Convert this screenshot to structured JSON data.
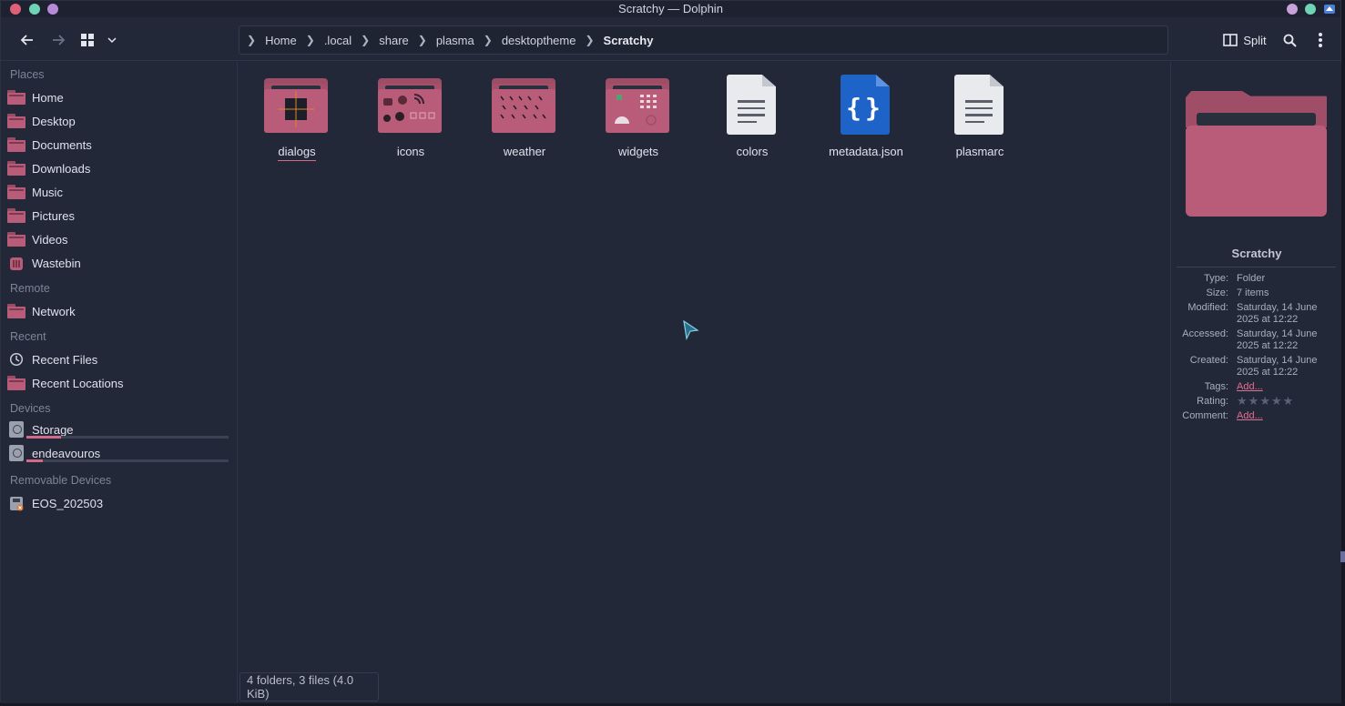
{
  "window": {
    "title": "Scratchy — Dolphin"
  },
  "colors": {
    "accent": "#d36a88",
    "folder": "#b85c79",
    "background": "#232838",
    "json_icon": "#1e63c7"
  },
  "toolbar": {
    "back_icon": "arrow-left-icon",
    "forward_icon": "arrow-right-icon",
    "view_icon": "icons-view-icon",
    "split_label": "Split",
    "search_icon": "search-icon",
    "menu_icon": "kebab-menu-icon"
  },
  "breadcrumb": [
    "Home",
    ".local",
    "share",
    "plasma",
    "desktoptheme",
    "Scratchy"
  ],
  "sidebar": {
    "places_title": "Places",
    "places": [
      {
        "label": "Home",
        "icon": "folder-home-icon"
      },
      {
        "label": "Desktop",
        "icon": "folder-desktop-icon"
      },
      {
        "label": "Documents",
        "icon": "folder-documents-icon"
      },
      {
        "label": "Downloads",
        "icon": "folder-downloads-icon"
      },
      {
        "label": "Music",
        "icon": "folder-music-icon"
      },
      {
        "label": "Pictures",
        "icon": "folder-pictures-icon"
      },
      {
        "label": "Videos",
        "icon": "folder-videos-icon"
      },
      {
        "label": "Wastebin",
        "icon": "wastebin-icon"
      }
    ],
    "remote_title": "Remote",
    "remote": [
      {
        "label": "Network",
        "icon": "folder-network-icon"
      }
    ],
    "recent_title": "Recent",
    "recent": [
      {
        "label": "Recent Files",
        "icon": "clock-icon"
      },
      {
        "label": "Recent Locations",
        "icon": "folder-recent-icon"
      }
    ],
    "devices_title": "Devices",
    "devices": [
      {
        "label": "Storage",
        "icon": "drive-icon",
        "usage_fraction": 0.17
      },
      {
        "label": "endeavouros",
        "icon": "drive-icon",
        "usage_fraction": 0.08
      }
    ],
    "removable_title": "Removable Devices",
    "removable": [
      {
        "label": "EOS_202503",
        "icon": "usb-drive-icon"
      }
    ]
  },
  "items": [
    {
      "name": "dialogs",
      "kind": "folder",
      "icon": "folder-dialogs-icon"
    },
    {
      "name": "icons",
      "kind": "folder",
      "icon": "folder-icons-icon"
    },
    {
      "name": "weather",
      "kind": "folder",
      "icon": "folder-weather-icon"
    },
    {
      "name": "widgets",
      "kind": "folder",
      "icon": "folder-widgets-icon"
    },
    {
      "name": "colors",
      "kind": "file",
      "icon": "text-file-icon"
    },
    {
      "name": "metadata.json",
      "kind": "json",
      "icon": "json-file-icon"
    },
    {
      "name": "plasmarc",
      "kind": "file",
      "icon": "text-file-icon"
    }
  ],
  "status": "4 folders, 3 files (4.0 KiB)",
  "info": {
    "name": "Scratchy",
    "rows": [
      {
        "key": "Type:",
        "value": "Folder"
      },
      {
        "key": "Size:",
        "value": "7 items"
      },
      {
        "key": "Modified:",
        "value": "Saturday, 14 June 2025 at 12:22"
      },
      {
        "key": "Accessed:",
        "value": "Saturday, 14 June 2025 at 12:22"
      },
      {
        "key": "Created:",
        "value": "Saturday, 14 June 2025 at 12:22"
      },
      {
        "key": "Tags:",
        "value": "Add..."
      },
      {
        "key": "Rating:",
        "value": ""
      },
      {
        "key": "Comment:",
        "value": "Add..."
      }
    ],
    "rating_stars": 0
  }
}
